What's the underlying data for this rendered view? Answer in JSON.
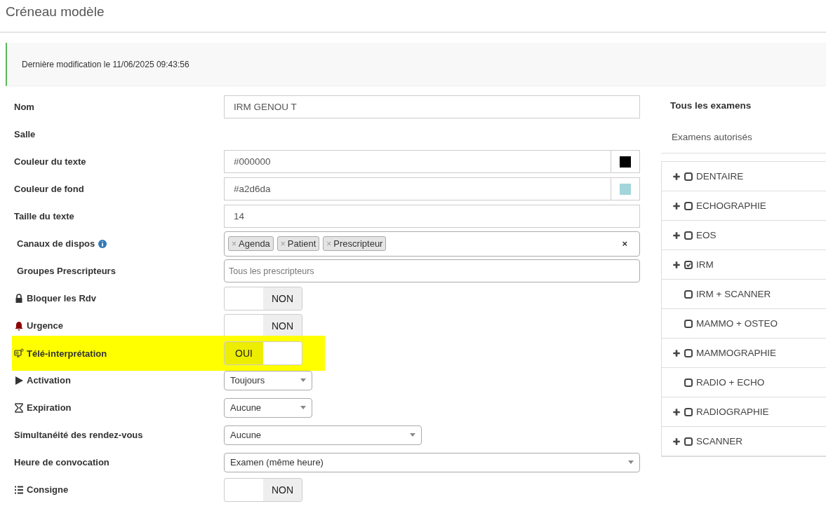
{
  "page_title": "Créneau modèle",
  "notice": "Dernière modification le 11/06/2025 09:43:56",
  "form": [
    {
      "kind": "text",
      "label": "Nom",
      "value": "IRM GENOU T"
    },
    {
      "kind": "empty",
      "label": "Salle"
    },
    {
      "kind": "color",
      "label": "Couleur du texte",
      "value": "#000000"
    },
    {
      "kind": "color",
      "label": "Couleur de fond",
      "value": "#a2d6da"
    },
    {
      "kind": "text",
      "label": "Taille du texte",
      "value": "14"
    },
    {
      "kind": "tags",
      "label": "Canaux de dispos",
      "tags": [
        "Agenda",
        "Patient",
        "Prescripteur"
      ],
      "clear": "×",
      "tag_remove": "×"
    },
    {
      "kind": "placeholder",
      "label": "Groupes Prescripteurs",
      "placeholder": "Tous les prescripteurs"
    },
    {
      "kind": "toggle",
      "label": "Bloquer les Rdv",
      "on": false,
      "text": "NON",
      "highlighted": false
    },
    {
      "kind": "toggle",
      "label": "Urgence",
      "on": false,
      "text": "NON",
      "highlighted": false
    },
    {
      "kind": "toggle",
      "label": "Télé-interprétation",
      "on": true,
      "text": "OUI",
      "highlighted": true
    },
    {
      "kind": "select",
      "label": "Activation",
      "value": "Toujours"
    },
    {
      "kind": "select",
      "label": "Expiration",
      "value": "Aucune"
    },
    {
      "kind": "select",
      "label": "Simultanéité des rendez-vous",
      "value": "Aucune"
    },
    {
      "kind": "select",
      "label": "Heure de convocation",
      "value": "Examen (même heure)"
    },
    {
      "kind": "toggle",
      "label": "Consigne",
      "on": false,
      "text": "NON",
      "highlighted": false
    }
  ],
  "exams": {
    "heading": "Tous les examens",
    "tab": "Examens autorisés",
    "items": [
      {
        "label": "DENTAIRE",
        "expandable": true,
        "checked": false
      },
      {
        "label": "ECHOGRAPHIE",
        "expandable": true,
        "checked": false
      },
      {
        "label": "EOS",
        "expandable": true,
        "checked": false
      },
      {
        "label": "IRM",
        "expandable": true,
        "checked": true
      },
      {
        "label": "IRM + SCANNER",
        "expandable": false,
        "checked": false
      },
      {
        "label": "MAMMO + OSTEO",
        "expandable": false,
        "checked": false
      },
      {
        "label": "MAMMOGRAPHIE",
        "expandable": true,
        "checked": false
      },
      {
        "label": "RADIO + ECHO",
        "expandable": false,
        "checked": false
      },
      {
        "label": "RADIOGRAPHIE",
        "expandable": true,
        "checked": false
      },
      {
        "label": "SCANNER",
        "expandable": true,
        "checked": false
      }
    ]
  }
}
